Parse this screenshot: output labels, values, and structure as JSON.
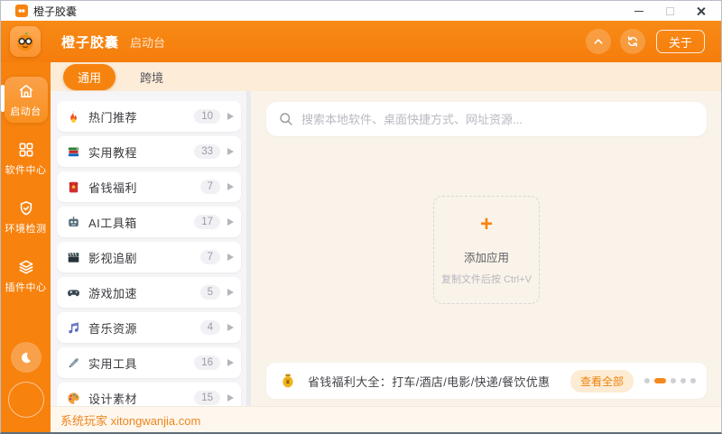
{
  "colors": {
    "primary": "#F7820E",
    "tabbar_bg": "#FCECD8",
    "panel_bg": "#FAF3E9",
    "footer_text": "#F0851C"
  },
  "titlebar": {
    "app_title": "橙子胶囊"
  },
  "header": {
    "app_name": "橙子胶囊",
    "subtitle": "启动台",
    "about_label": "关于"
  },
  "sidebar": {
    "items": [
      {
        "label": "启动台",
        "icon": "home-icon",
        "active": true
      },
      {
        "label": "软件中心",
        "icon": "grid-icon",
        "active": false
      },
      {
        "label": "环境检测",
        "icon": "shield-check-icon",
        "active": false
      },
      {
        "label": "插件中心",
        "icon": "layers-icon",
        "active": false
      }
    ]
  },
  "tabs": [
    {
      "label": "通用",
      "active": true
    },
    {
      "label": "跨境",
      "active": false
    }
  ],
  "list": {
    "items": [
      {
        "icon": "fire-icon",
        "label": "热门推荐",
        "count": "10"
      },
      {
        "icon": "books-icon",
        "label": "实用教程",
        "count": "33"
      },
      {
        "icon": "red-envelope-icon",
        "label": "省钱福利",
        "count": "7"
      },
      {
        "icon": "robot-icon",
        "label": "AI工具箱",
        "count": "17"
      },
      {
        "icon": "clapper-icon",
        "label": "影视追剧",
        "count": "7"
      },
      {
        "icon": "gamepad-icon",
        "label": "游戏加速",
        "count": "5"
      },
      {
        "icon": "music-note-icon",
        "label": "音乐资源",
        "count": "4"
      },
      {
        "icon": "pen-icon",
        "label": "实用工具",
        "count": "16"
      },
      {
        "icon": "palette-icon",
        "label": "设计素材",
        "count": "15"
      }
    ]
  },
  "search": {
    "placeholder": "搜索本地软件、桌面快捷方式、网址资源..."
  },
  "add_app": {
    "plus_symbol": "+",
    "title": "添加应用",
    "hint": "复制文件后按 Ctrl+V"
  },
  "promo": {
    "text": "省钱福利大全：打车/酒店/电影/快递/餐饮优惠",
    "button_label": "查看全部",
    "dots_total": 5,
    "active_dot_index": 1
  },
  "footer": {
    "text": "系统玩家 xitongwanjia.com"
  }
}
